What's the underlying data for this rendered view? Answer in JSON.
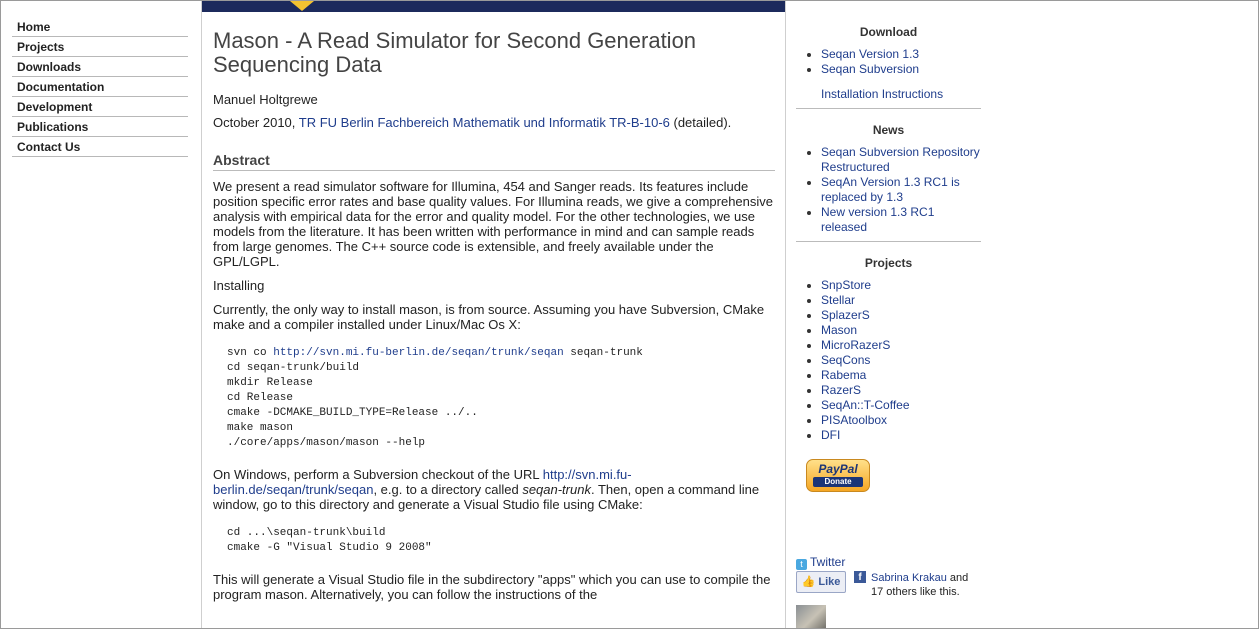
{
  "left_nav": [
    "Home",
    "Projects",
    "Downloads",
    "Documentation",
    "Development",
    "Publications",
    "Contact Us"
  ],
  "article": {
    "title": "Mason - A Read Simulator for Second Generation Sequencing Data",
    "author": "Manuel Holtgrewe",
    "date_prefix": "October 2010, ",
    "report_link": "TR FU Berlin Fachbereich Mathematik und Informatik TR-B-10-6",
    "date_suffix": " (detailed).",
    "abstract_heading": "Abstract",
    "abstract_text": "We present a read simulator software for Illumina, 454 and Sanger reads. Its features include position specific error rates and base quality values. For Illumina reads, we give a comprehensive analysis with empirical data for the error and quality model. For the other technologies, we use models from the literature. It has been written with performance in mind and can sample reads from large genomes. The C++ source code is extensible, and freely available under the GPL/LGPL.",
    "installing_heading": "Installing",
    "install_desc": "Currently, the only way to install mason, is from source. Assuming you have Subversion, CMake make and a compiler installed under Linux/Mac Os X:",
    "code1_first_prefix": "svn co ",
    "code1_first_link": "http://svn.mi.fu-berlin.de/seqan/trunk/seqan",
    "code1_first_suffix": " seqan-trunk",
    "code1_rest": "cd seqan-trunk/build\nmkdir Release\ncd Release\ncmake -DCMAKE_BUILD_TYPE=Release ../..\nmake mason\n./core/apps/mason/mason --help",
    "windows_prefix": "On Windows, perform a Subversion checkout of the URL ",
    "windows_link": "http://svn.mi.fu-berlin.de/seqan/trunk/seqan",
    "windows_mid": ", e.g. to a directory called ",
    "windows_em": "seqan-trunk",
    "windows_suffix": ". Then, open a command line window, go to this directory and generate a Visual Studio file using CMake:",
    "code2": "cd ...\\seqan-trunk\\build\ncmake -G \"Visual Studio 9 2008\"",
    "apps_text": "This will generate a Visual Studio file in the subdirectory \"apps\" which you can use to compile the program mason. Alternatively, you can follow the instructions of the"
  },
  "sidebar": {
    "download_heading": "Download",
    "download_links": [
      "Seqan Version 1.3",
      "Seqan Subversion"
    ],
    "install_instructions": "Installation Instructions",
    "news_heading": "News",
    "news_items": [
      "Seqan Subversion Repository Restructured",
      "SeqAn Version 1.3 RC1 is replaced by 1.3",
      "New version 1.3 RC1 released"
    ],
    "projects_heading": "Projects",
    "projects": [
      "SnpStore",
      "Stellar",
      "SplazerS",
      "Mason",
      "MicroRazerS",
      "SeqCons",
      "Rabema",
      "RazerS",
      "SeqAn::T-Coffee",
      "PISAtoolbox",
      "DFI"
    ],
    "paypal_top": "PayPal",
    "paypal_bottom": "Donate",
    "twitter": "Twitter",
    "like_button": "Like",
    "like_name": "Sabrina Krakau",
    "like_rest": " and 17 others like this."
  },
  "colors": {
    "banner": "#1c2a5c",
    "link": "#1f3d8c"
  }
}
